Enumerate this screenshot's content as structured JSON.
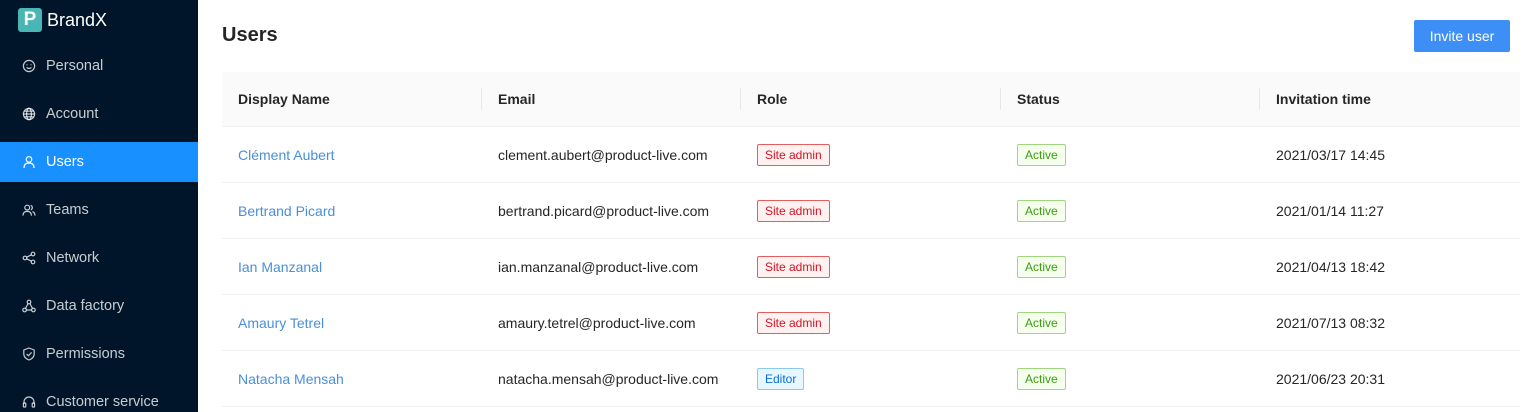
{
  "brand": {
    "logo_letter": "P",
    "name": "BrandX"
  },
  "sidebar": {
    "items": [
      {
        "label": "Personal",
        "icon": "smile-icon",
        "active": false
      },
      {
        "label": "Account",
        "icon": "globe-icon",
        "active": false
      },
      {
        "label": "Users",
        "icon": "user-icon",
        "active": true
      },
      {
        "label": "Teams",
        "icon": "team-icon",
        "active": false
      },
      {
        "label": "Network",
        "icon": "share-icon",
        "active": false
      },
      {
        "label": "Data factory",
        "icon": "cluster-icon",
        "active": false
      },
      {
        "label": "Permissions",
        "icon": "shield-icon",
        "active": false
      },
      {
        "label": "Customer service",
        "icon": "headset-icon",
        "active": false
      }
    ]
  },
  "main": {
    "title": "Users",
    "invite_label": "Invite user",
    "accent_color": "#3d8ef5"
  },
  "table": {
    "columns": [
      "Display Name",
      "Email",
      "Role",
      "Status",
      "Invitation time"
    ],
    "rows": [
      {
        "name": "Clément Aubert",
        "email": "clement.aubert@product-live.com",
        "role": "Site admin",
        "status": "Active",
        "invited": "2021/03/17 14:45"
      },
      {
        "name": "Bertrand Picard",
        "email": "bertrand.picard@product-live.com",
        "role": "Site admin",
        "status": "Active",
        "invited": "2021/01/14 11:27"
      },
      {
        "name": "Ian Manzanal",
        "email": "ian.manzanal@product-live.com",
        "role": "Site admin",
        "status": "Active",
        "invited": "2021/04/13 18:42"
      },
      {
        "name": "Amaury Tetrel",
        "email": "amaury.tetrel@product-live.com",
        "role": "Site admin",
        "status": "Active",
        "invited": "2021/07/13 08:32"
      },
      {
        "name": "Natacha Mensah",
        "email": "natacha.mensah@product-live.com",
        "role": "Editor",
        "status": "Active",
        "invited": "2021/06/23 20:31"
      }
    ]
  }
}
